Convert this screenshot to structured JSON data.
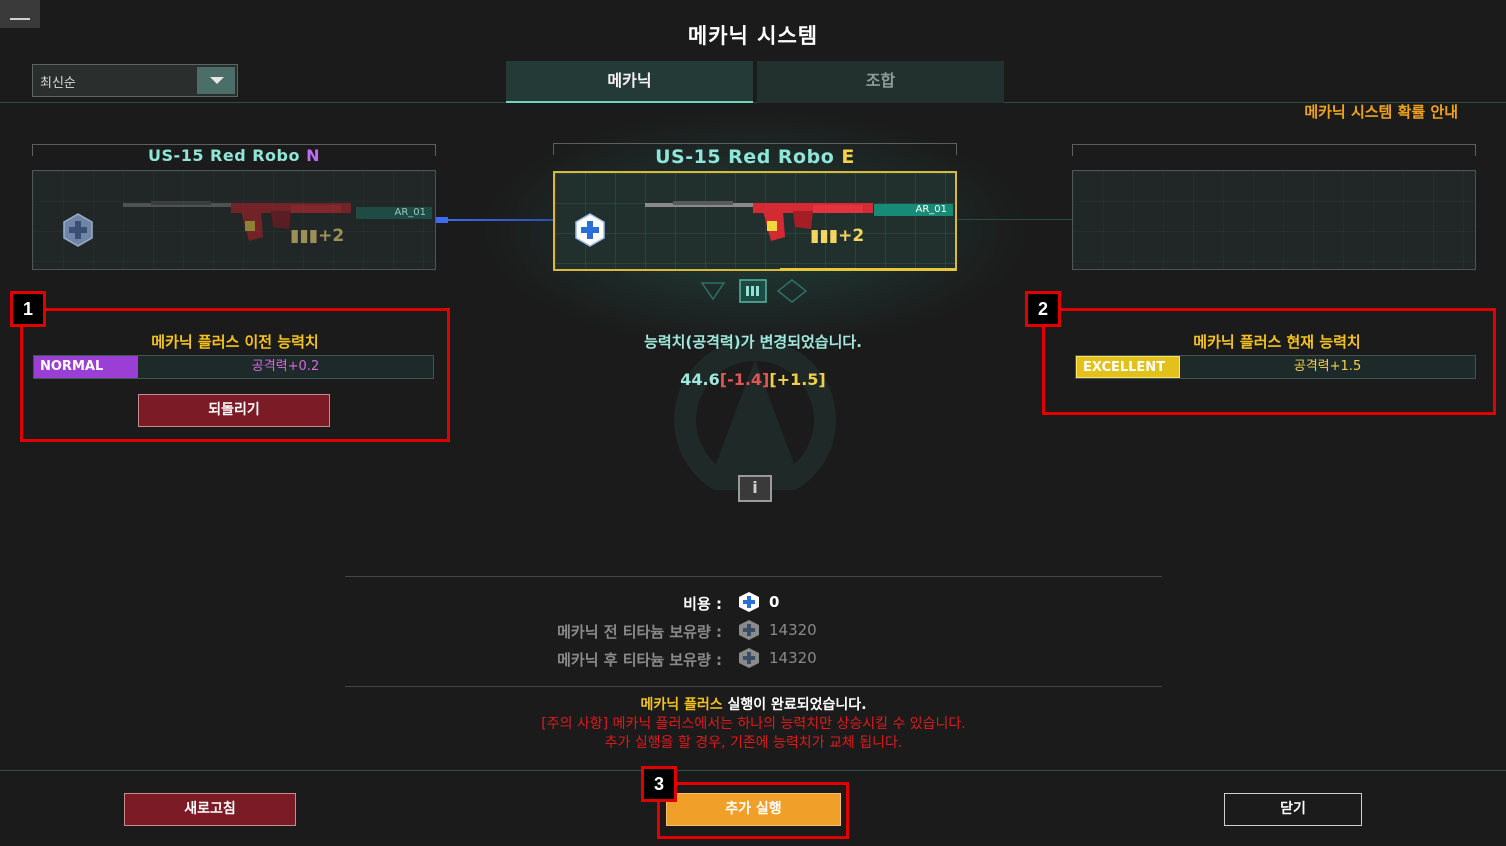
{
  "window": {
    "title": "메카닉 시스템"
  },
  "sort": {
    "value": "최신순"
  },
  "tabs": [
    {
      "label": "메카닉",
      "active": true
    },
    {
      "label": "조합",
      "active": false
    }
  ],
  "probability_guide": "메카닉 시스템 확률 안내",
  "slots": {
    "left": {
      "name": "US-15 Red Robo",
      "grade_letter": "N",
      "grade_color": "#c06cf5",
      "tag": "AR_01",
      "plus": "+2"
    },
    "center": {
      "name": "US-15 Red Robo",
      "grade_letter": "E",
      "grade_color": "#f3d24b",
      "tag": "AR_01",
      "plus": "+2"
    }
  },
  "previous_stats": {
    "title": "메카닉 플러스 이전 능력치",
    "grade": "NORMAL",
    "stat": "공격력+0.2",
    "revert_label": "되돌리기"
  },
  "current_stats": {
    "title": "메카닉 플러스 현재 능력치",
    "grade": "EXCELLENT",
    "stat": "공격력+1.5"
  },
  "change": {
    "message": "능력치(공격력)가 변경되었습니다.",
    "base": "44.6",
    "minus": "[-1.4]",
    "plus": "[+1.5]"
  },
  "cost": {
    "cost_label": "비용 :",
    "cost_value": "0",
    "before_label": "메카닉 전 티타늄 보유량 :",
    "before_value": "14320",
    "after_label": "메카닉 후 티타늄 보유량 :",
    "after_value": "14320"
  },
  "notice": {
    "complete_highlight": "메카닉 플러스",
    "complete_rest": " 실행이 완료되었습니다.",
    "warning": "[주의 사항] 메카닉 플러스에서는 하나의 능력치만 상승시킬 수 있습니다.",
    "replace": "추가 실행을 할 경우, 기존에 능력치가 교체 됩니다."
  },
  "buttons": {
    "refresh": "새로고침",
    "extra_run": "추가 실행",
    "close": "닫기"
  },
  "annotations": [
    "1",
    "2",
    "3"
  ],
  "icons": {
    "minimize": "minimize-icon",
    "dropdown": "chevron-down-icon",
    "titanium": "titanium-plus-icon",
    "info": "info-icon"
  }
}
